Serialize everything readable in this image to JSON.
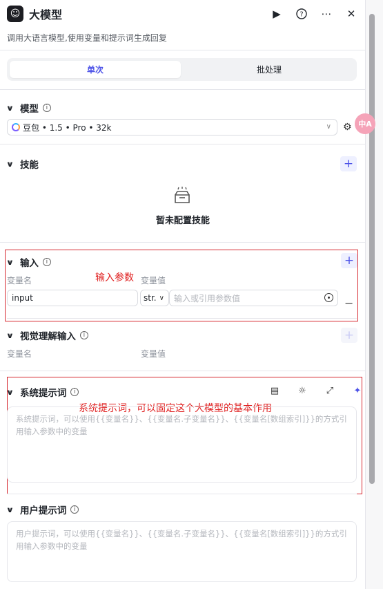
{
  "header": {
    "title": "大模型",
    "description": "调用大语言模型,使用变量和提示词生成回复"
  },
  "tabs": [
    {
      "label": "单次"
    },
    {
      "label": "批处理"
    }
  ],
  "model": {
    "section_title": "模型",
    "selected": "豆包 • 1.5 • Pro • 32k"
  },
  "skills": {
    "section_title": "技能",
    "empty_text": "暂未配置技能"
  },
  "input": {
    "section_title": "输入",
    "annotation": "输入参数",
    "col_name": "变量名",
    "col_value": "变量值",
    "row": {
      "name": "input",
      "type": "str.",
      "value_placeholder": "输入或引用参数值"
    }
  },
  "vision": {
    "section_title": "视觉理解输入",
    "col_name": "变量名",
    "col_value": "变量值"
  },
  "system_prompt": {
    "section_title": "系统提示词",
    "annotation": "系统提示词，可以固定这个大模型的基本作用",
    "placeholder": "系统提示词，可以使用{{变量名}}、{{变量名.子变量名}}、{{变量名[数组索引]}}的方式引用输入参数中的变量"
  },
  "user_prompt": {
    "section_title": "用户提示词",
    "placeholder": "用户提示词，可以使用{{变量名}}、{{变量名.子变量名}}、{{变量名[数组索引]}}的方式引用输入参数中的变量"
  },
  "floating": {
    "translate_label": "中A"
  },
  "colors": {
    "accent": "#4d53e8",
    "annotation_red": "#e02020"
  }
}
